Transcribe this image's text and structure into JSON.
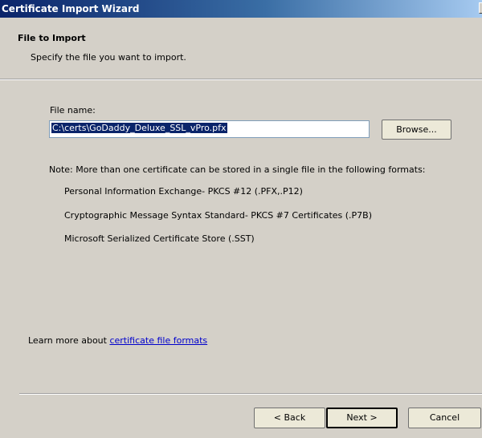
{
  "window": {
    "title": "Certificate Import Wizard",
    "close_glyph": "X"
  },
  "header": {
    "title": "File to Import",
    "subtitle": "Specify the file you want to import."
  },
  "file": {
    "label": "File name:",
    "value": "C:\\certs\\GoDaddy_Deluxe_SSL_vPro.pfx",
    "browse_label": "Browse..."
  },
  "note": "Note:  More than one certificate can be stored in a single file in the following formats:",
  "formats": [
    "Personal Information Exchange- PKCS #12 (.PFX,.P12)",
    "Cryptographic Message Syntax Standard- PKCS #7 Certificates (.P7B)",
    "Microsoft Serialized Certificate Store (.SST)"
  ],
  "learn_more": {
    "prefix": "Learn more about ",
    "link": "certificate file formats"
  },
  "buttons": {
    "back": "< Back",
    "next": "Next >",
    "cancel": "Cancel"
  }
}
